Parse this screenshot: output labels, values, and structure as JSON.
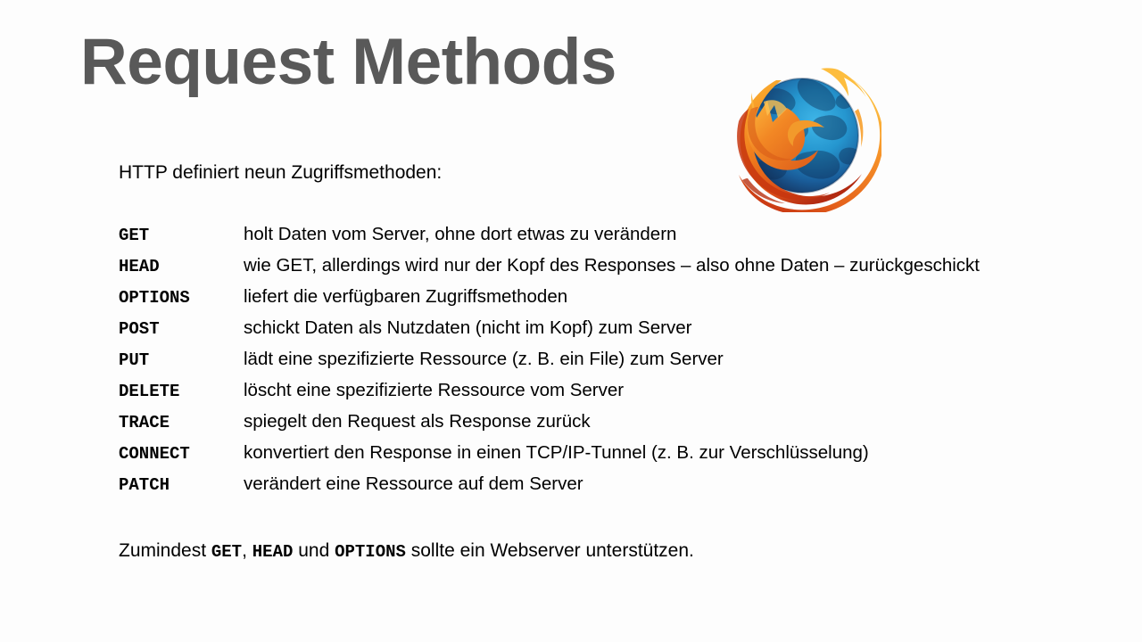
{
  "slide": {
    "title": "Request Methods",
    "intro": "HTTP definiert neun Zugriffsmethoden:",
    "methods": [
      {
        "name": "GET",
        "description": "holt Daten vom Server, ohne dort etwas zu verändern"
      },
      {
        "name": "HEAD",
        "description": "wie GET, allerdings wird nur der Kopf des Responses – also ohne Daten – zurückgeschickt"
      },
      {
        "name": "OPTIONS",
        "description": "liefert die verfügbaren Zugriffsmethoden"
      },
      {
        "name": "POST",
        "description": "schickt Daten als Nutzdaten (nicht im Kopf) zum Server"
      },
      {
        "name": "PUT",
        "description": "lädt eine spezifizierte Ressource (z. B. ein File) zum Server"
      },
      {
        "name": "DELETE",
        "description": "löscht eine spezifizierte Ressource vom Server"
      },
      {
        "name": "TRACE",
        "description": "spiegelt den Request als Response zurück"
      },
      {
        "name": "CONNECT",
        "description": "konvertiert den Response in einen TCP/IP-Tunnel (z. B. zur Verschlüsselung)"
      },
      {
        "name": "PATCH",
        "description": "verändert eine Ressource auf dem Server"
      }
    ],
    "footer": {
      "part1": "Zumindest ",
      "mono1": "GET",
      "part2": ", ",
      "mono2": "HEAD",
      "part3": " und ",
      "mono3": "OPTIONS",
      "part4": " sollte ein Webserver unterstützen."
    },
    "logo": {
      "name": "firefox-logo",
      "colors": {
        "globe_dark": "#17345f",
        "globe_mid": "#1d6ea8",
        "globe_light": "#2ba6dd",
        "fox_light": "#f9a82e",
        "fox_mid": "#ef7c1b",
        "fox_deep": "#d8471b",
        "fox_dark_red": "#b82c12"
      }
    },
    "colors": {
      "background": "#fdfdfd",
      "title": "#595959",
      "text": "#000000"
    }
  }
}
